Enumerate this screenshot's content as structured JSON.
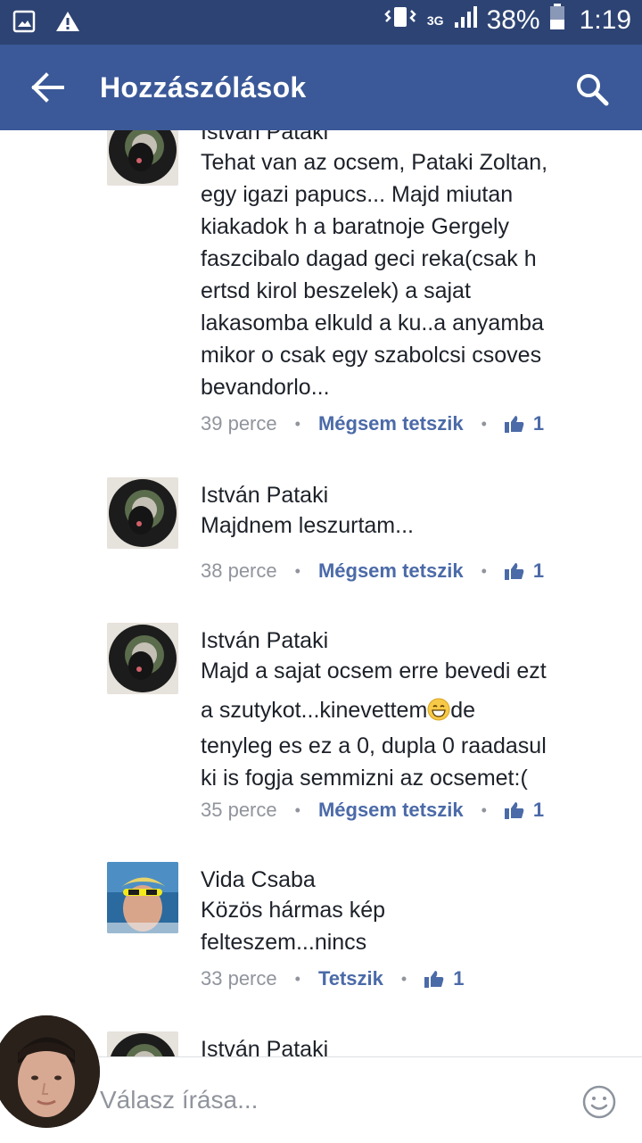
{
  "status_bar": {
    "network": "3G",
    "battery": "38%",
    "time": "1:19",
    "icons": [
      "gallery-icon",
      "warning-icon",
      "vibrate-icon",
      "signal-icon",
      "battery-icon"
    ]
  },
  "app_bar": {
    "title": "Hozzászólások",
    "back_icon": "arrow-left-icon",
    "search_icon": "search-icon",
    "background": "#3b5998"
  },
  "comments": [
    {
      "author": "István Pataki",
      "lines": [
        "Tehat van az ocsem, Pataki Zoltan,",
        "egy igazi papucs... Majd miutan",
        "kiakadok h a baratnoje Gergely",
        "faszcibalo dagad geci reka(csak h",
        "ertsd kirol beszelek) a sajat",
        "lakasomba elkuld a ku..a anyamba",
        "mikor o csak egy szabolcsi csoves",
        "bevandorlo..."
      ],
      "time": "39 perce",
      "like_label": "Mégsem tetszik",
      "likes": "1"
    },
    {
      "author": "István Pataki",
      "lines": [
        "Majdnem leszurtam..."
      ],
      "time": "38 perce",
      "like_label": "Mégsem tetszik",
      "likes": "1"
    },
    {
      "author": "István Pataki",
      "lines": [
        "Majd a sajat ocsem erre bevedi ezt",
        "a szutykot...kinevettem",
        "de",
        "tenyleg es ez a 0, dupla 0 raadasul",
        "ki is fogja semmizni az ocsemet:("
      ],
      "time": "35 perce",
      "like_label": "Mégsem tetszik",
      "likes": "1"
    },
    {
      "author": "Vida Csaba",
      "lines": [
        "Közös hármas kép",
        "felteszem...nincs"
      ],
      "time": "33 perce",
      "like_label": "Tetszik",
      "likes": "1"
    },
    {
      "author": "István Pataki"
    }
  ],
  "reply": {
    "placeholder": "Válasz írása...",
    "emoji_icon": "smiley-icon"
  }
}
